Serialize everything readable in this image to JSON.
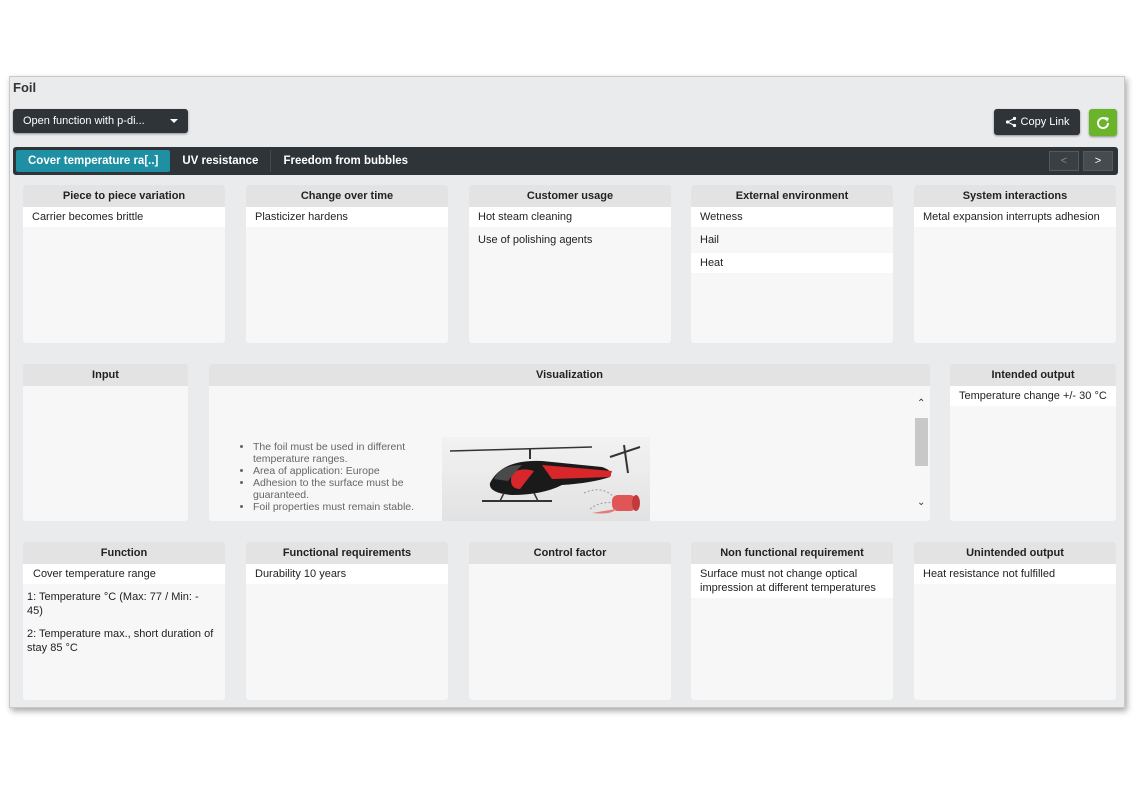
{
  "window": {
    "title": "Foil"
  },
  "toolbar": {
    "dropdown_label": "Open function with p-di...",
    "copy_link_label": "Copy Link",
    "refresh_color": "#6ab42a"
  },
  "tabs": [
    {
      "label": "Cover temperature ra[..]",
      "active": true
    },
    {
      "label": "UV resistance",
      "active": false
    },
    {
      "label": "Freedom from bubbles",
      "active": false
    }
  ],
  "tab_nav": {
    "prev": "<",
    "next": ">"
  },
  "noise_panels": [
    {
      "title": "Piece to piece variation",
      "items": [
        "Carrier becomes brittle"
      ]
    },
    {
      "title": "Change over time",
      "items": [
        "Plasticizer hardens"
      ]
    },
    {
      "title": "Customer usage",
      "items": [
        "Hot steam cleaning",
        "Use of polishing agents"
      ]
    },
    {
      "title": "External environment",
      "items": [
        "Wetness",
        "Hail",
        "Heat"
      ]
    },
    {
      "title": "System interactions",
      "items": [
        "Metal expansion interrupts adhesion"
      ]
    }
  ],
  "input": {
    "title": "Input"
  },
  "visualization": {
    "title": "Visualization",
    "bullets": [
      "The foil must be used in different temperature ranges.",
      "Area of application: Europe",
      "Adhesion to the surface must be guaranteed.",
      "Foil properties must remain stable."
    ],
    "scroll_up": "⌃",
    "scroll_down": "⌄"
  },
  "intended_output": {
    "title": "Intended output",
    "items": [
      "Temperature change +/- 30 °C"
    ]
  },
  "bottom_panels": [
    {
      "title": "Function",
      "items": [
        "Cover temperature range",
        "1: Temperature °C (Max: 77 / Min: - 45)",
        "2: Temperature max., short duration of stay 85 °C"
      ]
    },
    {
      "title": "Functional requirements",
      "items": [
        "Durability 10 years"
      ]
    },
    {
      "title": "Control factor",
      "items": []
    },
    {
      "title": "Non functional requirement",
      "items": [
        "Surface must not change optical impression at different temperatures"
      ]
    },
    {
      "title": "Unintended output",
      "items": [
        "Heat resistance not fulfilled"
      ]
    }
  ],
  "colors": {
    "accent": "#1f8fa3",
    "dark": "#2f3438",
    "green": "#6ab42a"
  }
}
